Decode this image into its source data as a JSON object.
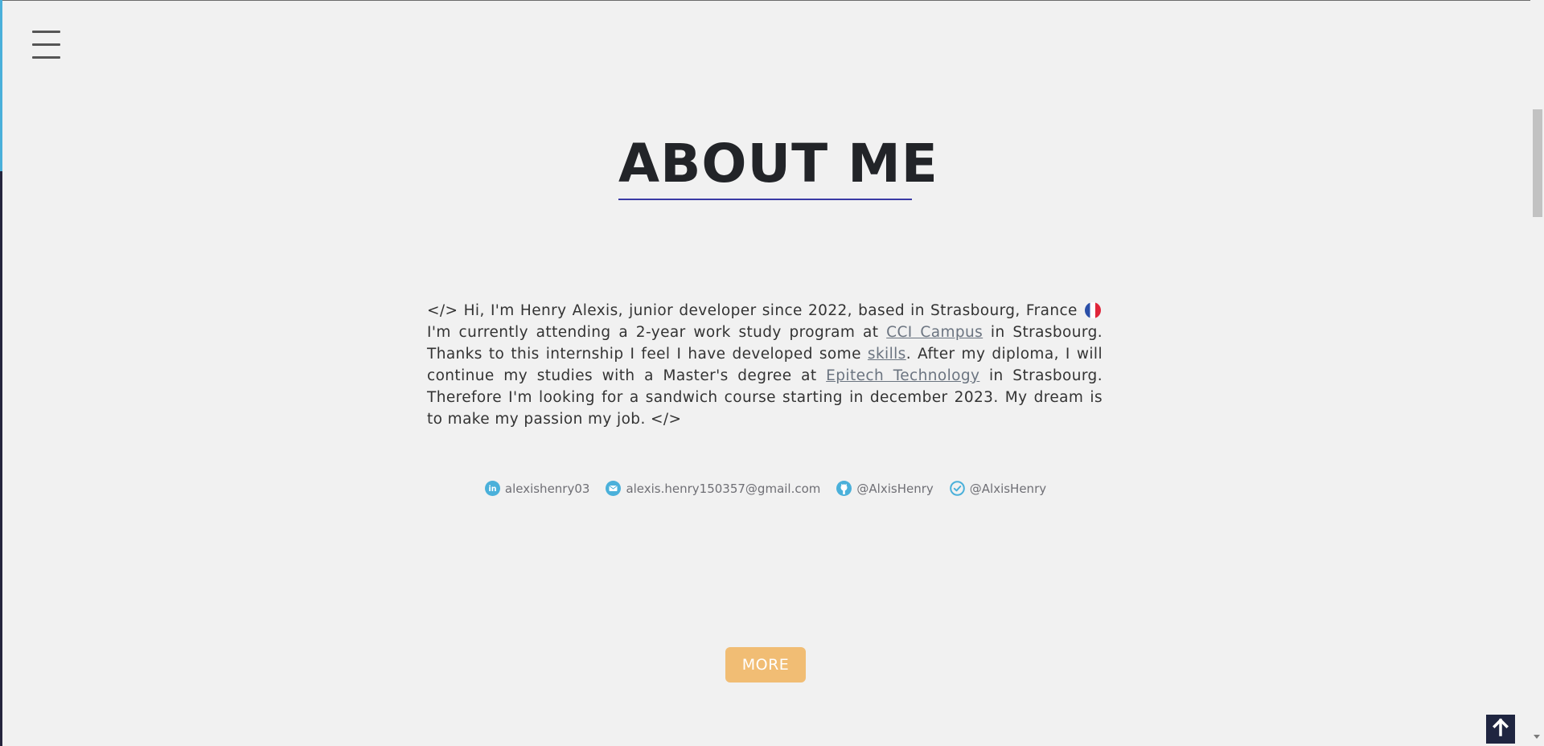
{
  "header": {
    "menu_icon": "hamburger-menu-icon"
  },
  "scroll_progress": 0.23,
  "about": {
    "title": "ABOUT ME",
    "bio": {
      "p1": "</> Hi, I'm Henry Alexis, junior developer since 2022, based in Strasbourg, France",
      "flag_icon": "france-flag-icon",
      "p2": " I'm currently attending a 2-year work study program at ",
      "link1": "CCI Campus",
      "p3": " in Strasbourg. Thanks to this internship I feel I have developed some ",
      "link2": "skills",
      "p4": ". After my diploma, I will continue my studies with a Master's degree at ",
      "link3": "Epitech Technology",
      "p5": " in Strasbourg. Therefore I'm looking for a sandwich course starting in december 2023. My dream is to make my passion my job. </>"
    }
  },
  "socials": [
    {
      "icon": "linkedin-icon",
      "label": "alexishenry03"
    },
    {
      "icon": "mail-icon",
      "label": "alexis.henry150357@gmail.com"
    },
    {
      "icon": "github-icon",
      "label": "@AlxisHenry"
    },
    {
      "icon": "check-circle-icon",
      "label": "@AlxisHenry"
    }
  ],
  "more_button": {
    "label": "MORE"
  },
  "to_top_button": {
    "icon": "arrow-up-icon"
  },
  "colors": {
    "background": "#f1f1f1",
    "accent_blue": "#4ab0da",
    "title_underline": "#3a3aa5",
    "more_button": "#f1bd74",
    "to_top": "#1f2540"
  }
}
